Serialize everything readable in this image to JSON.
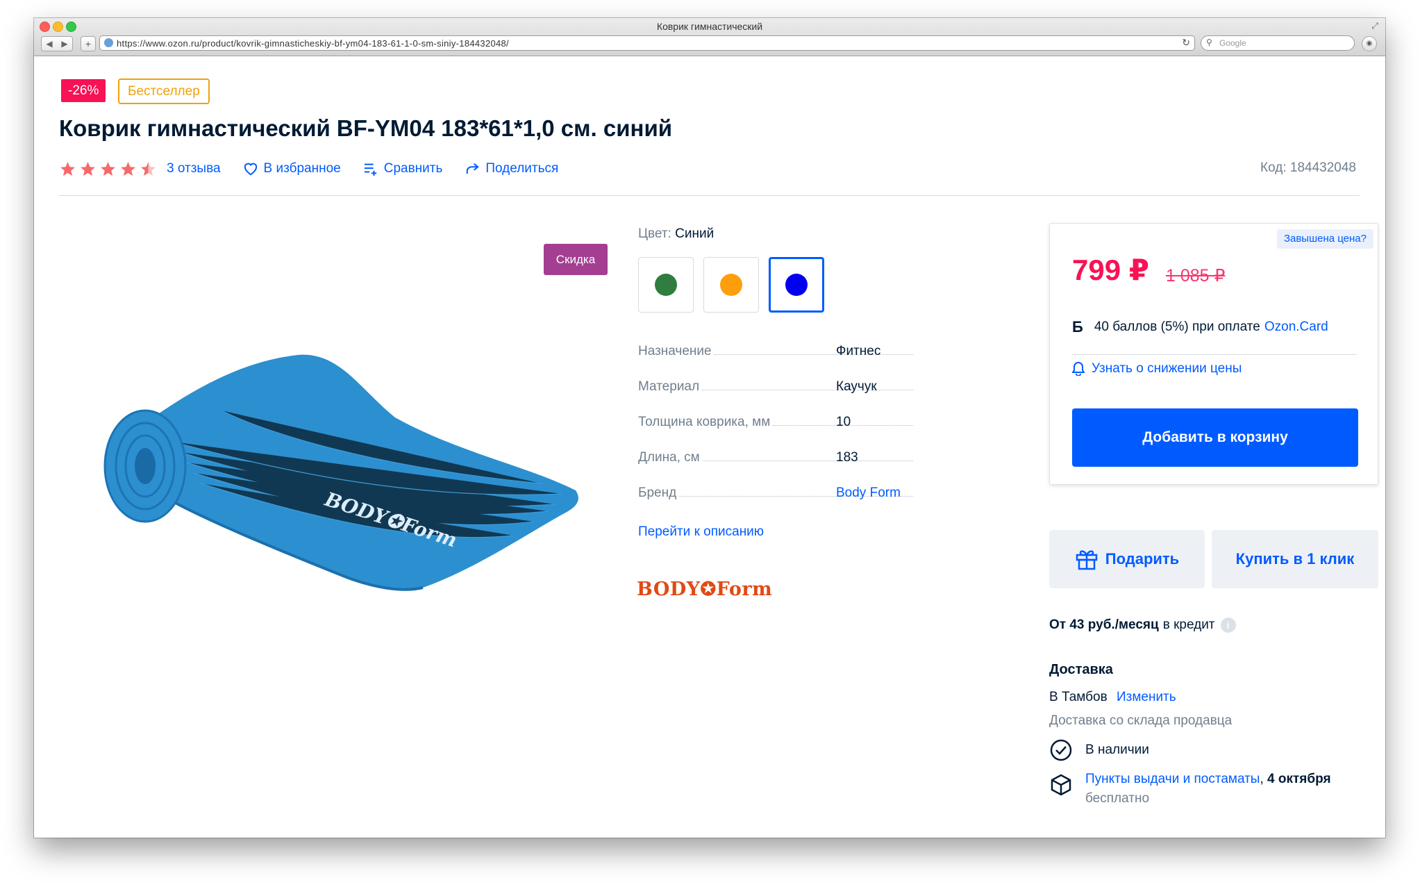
{
  "browser": {
    "window_title": "Коврик гимнастический",
    "url": "https://www.ozon.ru/product/kovrik-gimnasticheskiy-bf-ym04-183-61-1-0-sm-siniy-184432048/",
    "search_placeholder": "Google"
  },
  "product": {
    "badges": {
      "discount": "-26%",
      "bestseller": "Бестселлер"
    },
    "title": "Коврик гимнастический BF-YM04 183*61*1,0 см. синий",
    "rating": 4.5,
    "reviews_label": "3 отзыва",
    "favorite_label": "В избранное",
    "compare_label": "Сравнить",
    "share_label": "Поделиться",
    "code_label": "Код: 184432048",
    "discount_tag": "Скидка",
    "mat_color": "#2c8fd0",
    "mat_text": "BODY✪Form"
  },
  "color": {
    "label": "Цвет:",
    "value": "Синий",
    "swatches": [
      {
        "color": "#2f7d3f",
        "selected": false
      },
      {
        "color": "#ff9e0d",
        "selected": false
      },
      {
        "color": "#0000f0",
        "selected": true
      }
    ]
  },
  "specs": [
    {
      "name": "Назначение",
      "value": "Фитнес",
      "is_link": false
    },
    {
      "name": "Материал",
      "value": "Каучук",
      "is_link": false
    },
    {
      "name": "Толщина коврика, мм",
      "value": "10",
      "is_link": false
    },
    {
      "name": "Длина, см",
      "value": "183",
      "is_link": false
    },
    {
      "name": "Бренд",
      "value": "Body Form",
      "is_link": true
    }
  ],
  "goto_description": "Перейти к описанию",
  "brand_logo_text": "BODY✪Form",
  "price_card": {
    "overprice_label": "Завышена цена?",
    "price": "799 ₽",
    "old_price": "1 085 ₽",
    "bonus_icon": "Б",
    "bonus_text": "40 баллов (5%) при оплате ",
    "bonus_link": "Ozon.Card",
    "notify_label": "Узнать о снижении цены",
    "add_to_cart": "Добавить в корзину"
  },
  "buttons": {
    "gift": "Подарить",
    "one_click": "Купить в 1 клик"
  },
  "credit": {
    "amount": "От 43 руб./месяц",
    "suffix": "в кредит",
    "info": "i"
  },
  "delivery": {
    "title": "Доставка",
    "city": "В Тамбов",
    "change_label": "Изменить",
    "source": "Доставка со склада продавца",
    "in_stock": "В наличии",
    "pickup_link": "Пункты выдачи и постаматы",
    "pickup_date": "4 октября",
    "pickup_price": "бесплатно"
  },
  "colors": {
    "accent": "#005bff",
    "price": "#f91155",
    "text": "#001a34",
    "muted": "#707f8d"
  }
}
